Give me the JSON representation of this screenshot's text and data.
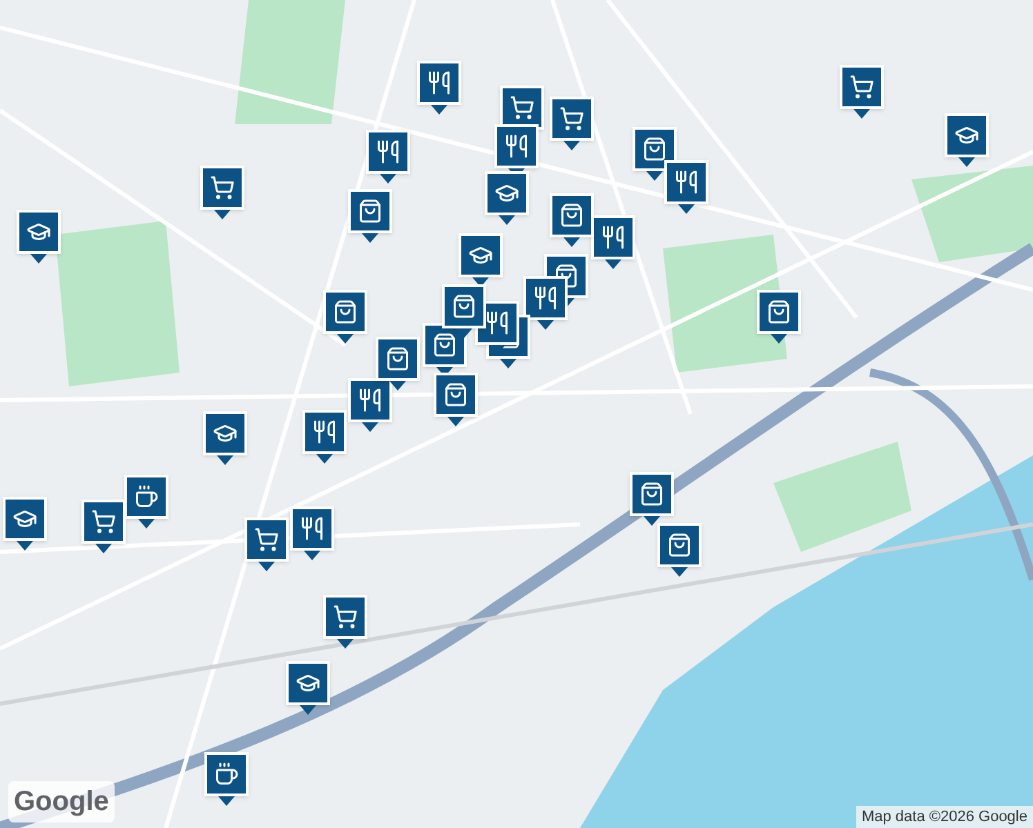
{
  "map": {
    "markers": [
      {
        "kind": "restaurant"
      },
      {
        "kind": "grocery"
      },
      {
        "kind": "grocery"
      },
      {
        "kind": "restaurant"
      },
      {
        "kind": "restaurant"
      },
      {
        "kind": "shopping"
      },
      {
        "kind": "grocery"
      },
      {
        "kind": "school"
      },
      {
        "kind": "restaurant"
      },
      {
        "kind": "restaurant"
      },
      {
        "kind": "shopping"
      },
      {
        "kind": "shopping"
      },
      {
        "kind": "grocery"
      },
      {
        "kind": "school"
      },
      {
        "kind": "shopping"
      },
      {
        "kind": "restaurant"
      },
      {
        "kind": "school"
      },
      {
        "kind": "shopping"
      },
      {
        "kind": "shopping"
      },
      {
        "kind": "restaurant"
      },
      {
        "kind": "shopping"
      },
      {
        "kind": "shopping"
      },
      {
        "kind": "shopping"
      },
      {
        "kind": "shopping"
      },
      {
        "kind": "shopping"
      },
      {
        "kind": "restaurant"
      },
      {
        "kind": "restaurant"
      },
      {
        "kind": "school"
      },
      {
        "kind": "cafe"
      },
      {
        "kind": "school"
      },
      {
        "kind": "grocery"
      },
      {
        "kind": "restaurant"
      },
      {
        "kind": "grocery"
      },
      {
        "kind": "shopping"
      },
      {
        "kind": "shopping"
      },
      {
        "kind": "grocery"
      },
      {
        "kind": "school"
      },
      {
        "kind": "school"
      },
      {
        "kind": "cafe"
      }
    ]
  },
  "logo": "Google",
  "attribution": "Map data ©2026 Google"
}
